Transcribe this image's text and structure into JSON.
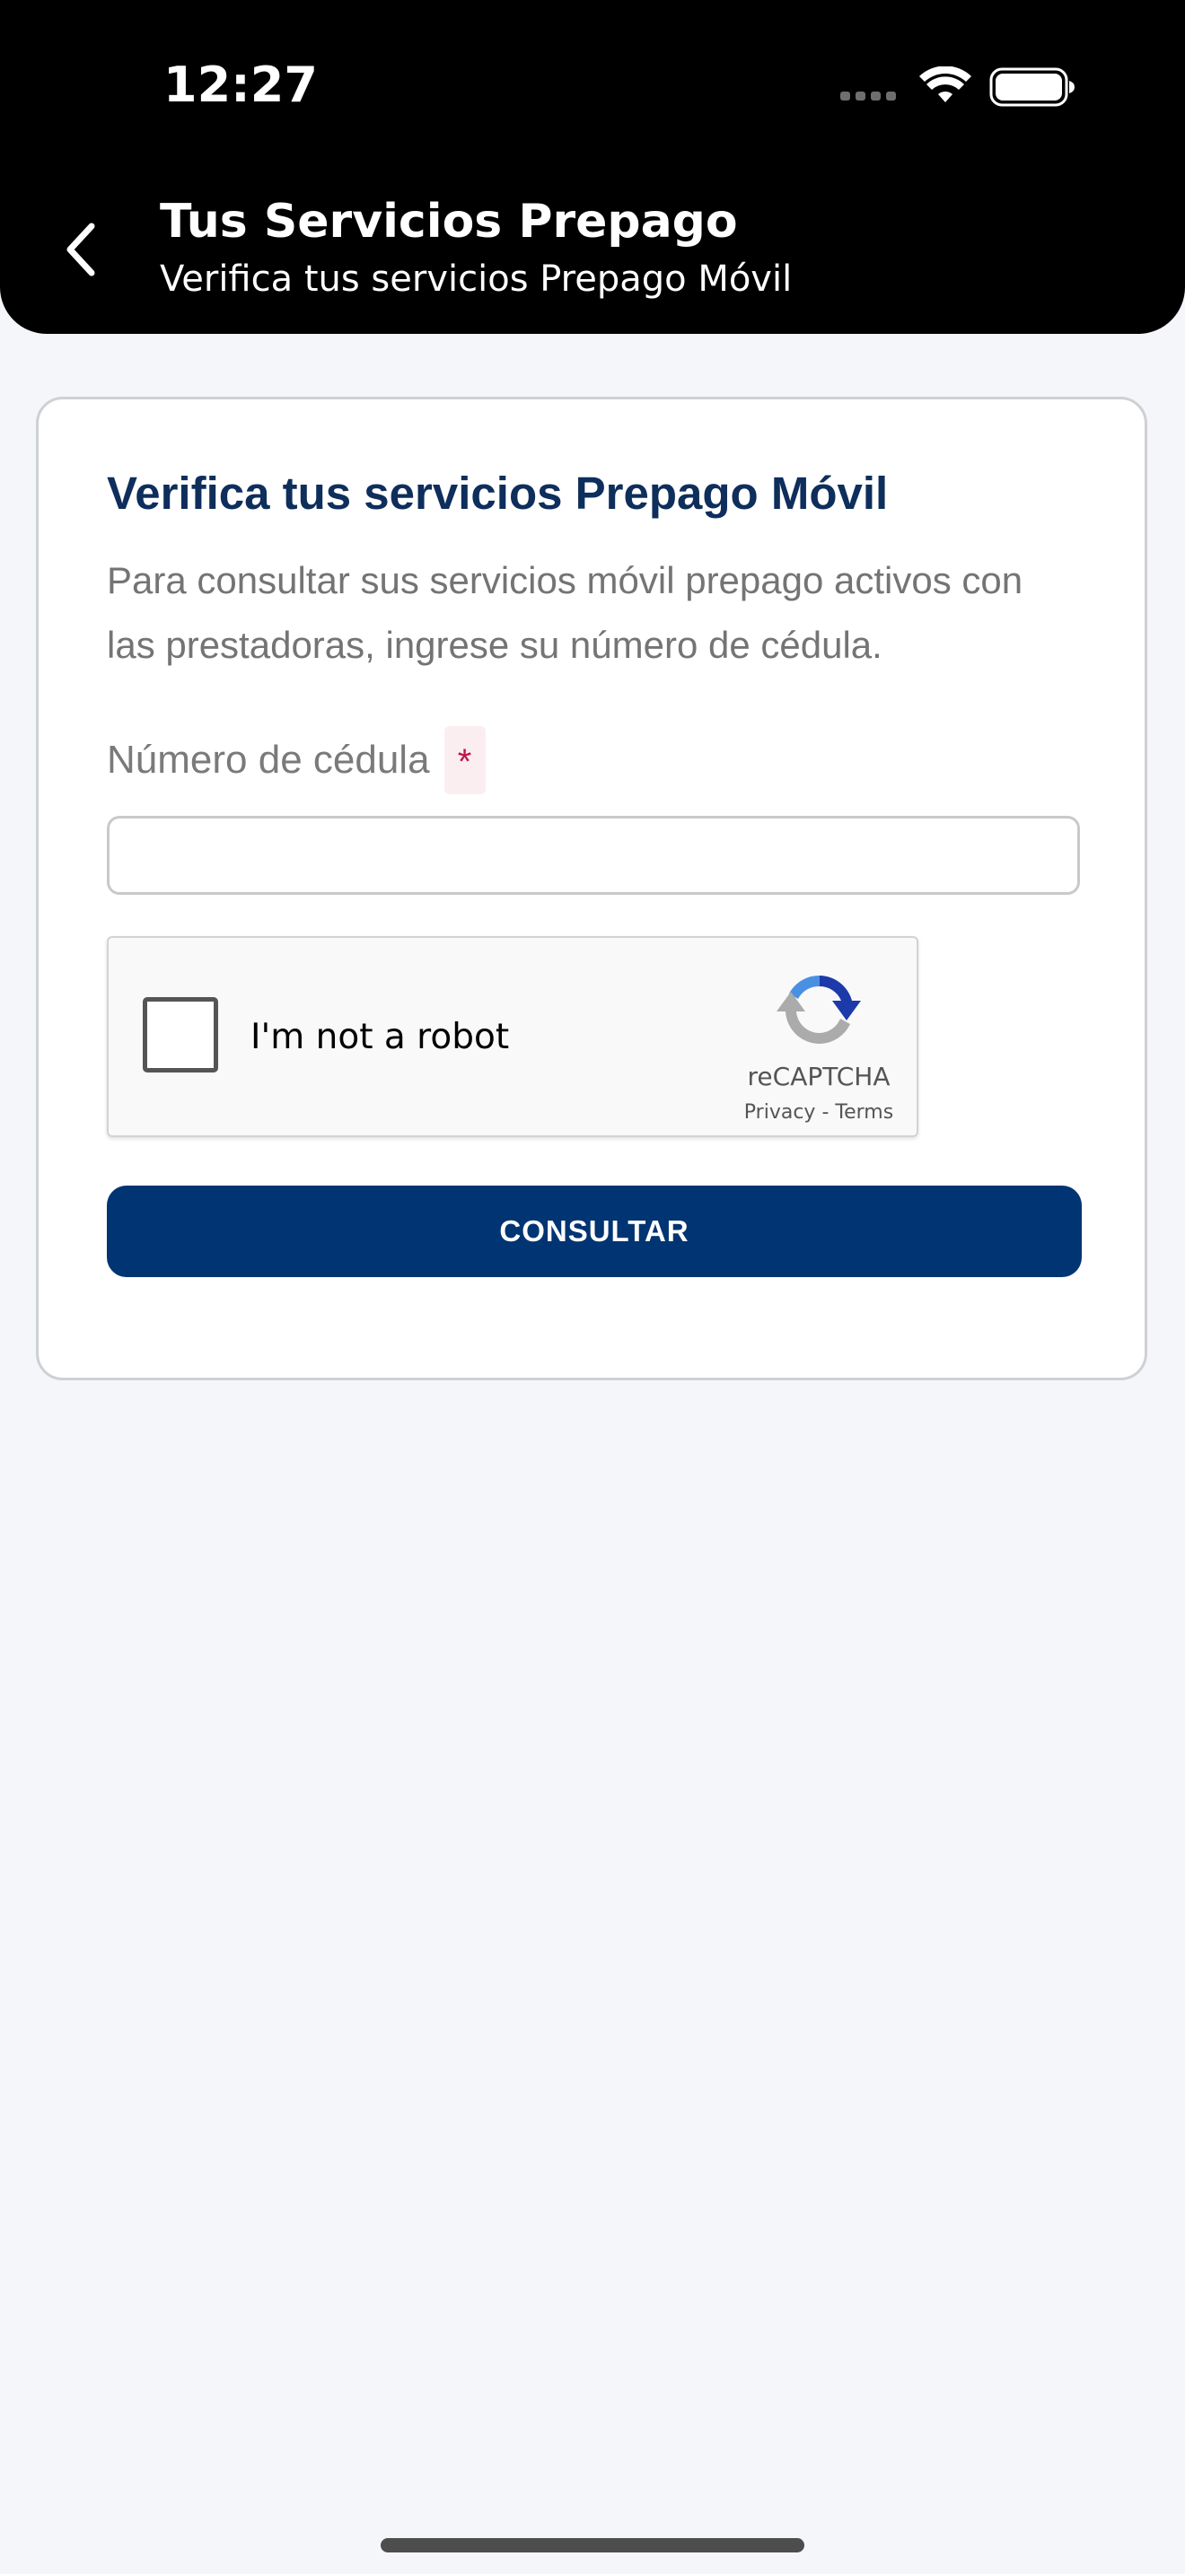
{
  "status_bar": {
    "time": "12:27",
    "icons": [
      "signal-icon",
      "wifi-icon",
      "battery-icon"
    ]
  },
  "header": {
    "back_icon": "chevron-left-icon",
    "title": "Tus Servicios Prepago",
    "subtitle": "Verifica tus servicios Prepago Móvil"
  },
  "card": {
    "title": "Verifica tus servicios Prepago Móvil",
    "description": "Para consultar sus servicios móvil prepago activos con las prestadoras, ingrese su número de cédula.",
    "cedula_label": "Número de cédula",
    "required_mark": "*",
    "cedula_value": "",
    "recaptcha": {
      "label": "I'm not a robot",
      "brand": "reCAPTCHA",
      "privacy": "Privacy",
      "separator": "-",
      "terms": "Terms",
      "checked": false
    },
    "submit_label": "CONSULTAR"
  },
  "colors": {
    "header_bg": "#000000",
    "page_bg": "#f5f6fa",
    "title_navy": "#0e2e5c",
    "button_bg": "#003472",
    "required_red": "#c0144a"
  }
}
